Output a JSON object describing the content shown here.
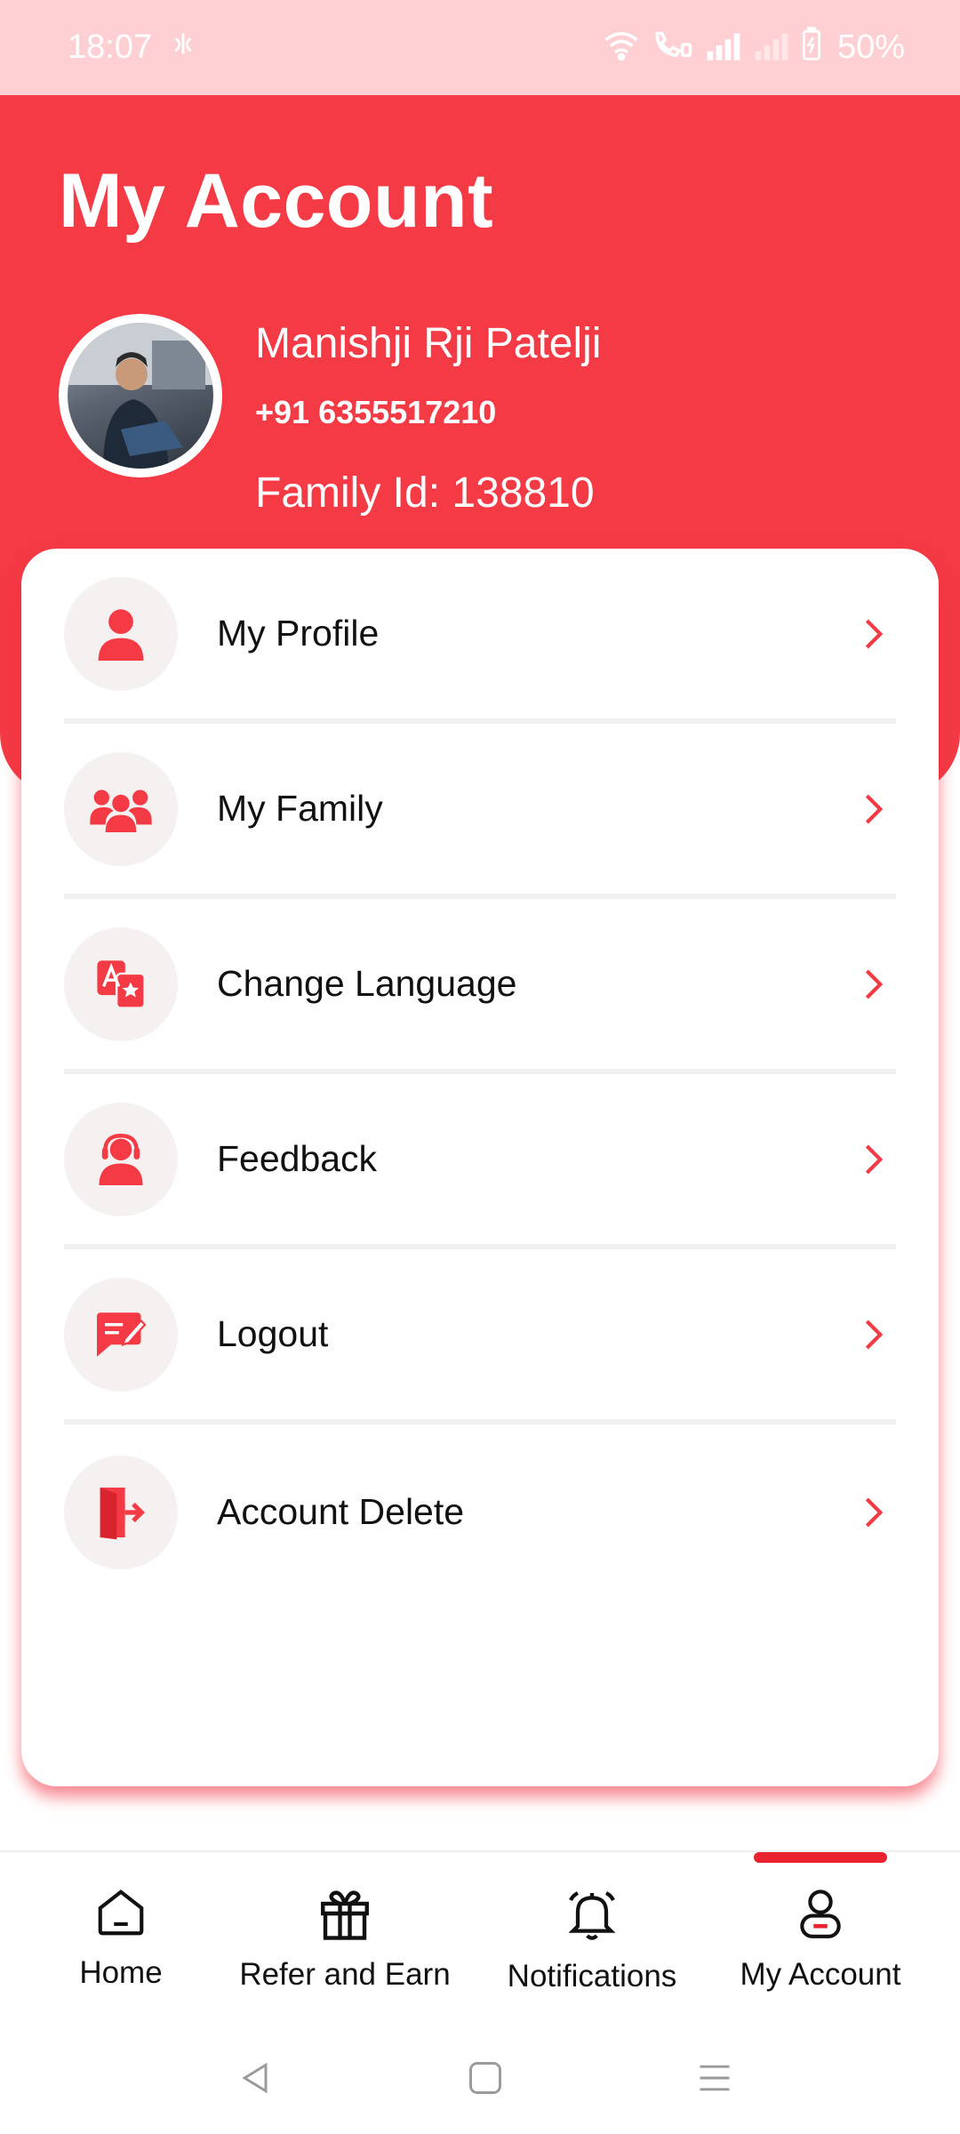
{
  "status_bar": {
    "time": "18:07",
    "battery": "50%"
  },
  "header": {
    "title": "My Account",
    "user_name": "Manishji Rji Patelji",
    "phone": "+91 6355517210",
    "family_id": "Family Id: 138810"
  },
  "menu": {
    "items": [
      {
        "label": "My Profile",
        "icon": "user-icon"
      },
      {
        "label": "My Family",
        "icon": "family-icon"
      },
      {
        "label": "Change Language",
        "icon": "translate-icon"
      },
      {
        "label": "Feedback",
        "icon": "support-agent-icon"
      },
      {
        "label": "Logout",
        "icon": "message-edit-icon"
      },
      {
        "label": "Account Delete",
        "icon": "door-exit-icon"
      }
    ]
  },
  "bottom_nav": {
    "items": [
      {
        "label": "Home",
        "icon": "home-icon"
      },
      {
        "label": "Refer and Earn",
        "icon": "gift-icon"
      },
      {
        "label": "Notifications",
        "icon": "bell-icon"
      },
      {
        "label": "My Account",
        "icon": "account-icon",
        "active": true
      }
    ]
  },
  "colors": {
    "accent": "#f33a45",
    "status_bar": "#ffd0d3"
  }
}
